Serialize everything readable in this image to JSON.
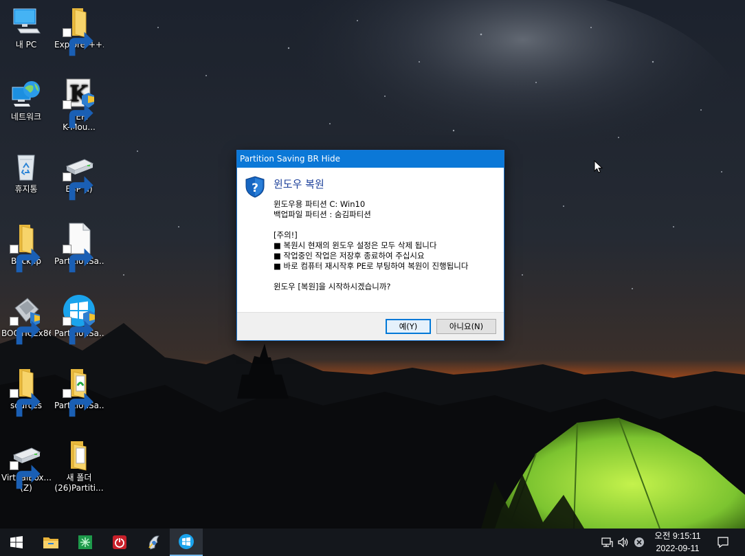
{
  "desktop": {
    "icons": [
      {
        "label": "내 PC",
        "icon": "this-pc-icon"
      },
      {
        "label": "Explorer++...",
        "icon": "folder-icon"
      },
      {
        "label": "네트워크",
        "icon": "network-icon"
      },
      {
        "label_line1": "UEFI",
        "label_line2": "K-Mou...",
        "icon": "k-mouse-icon"
      },
      {
        "label": "휴지통",
        "icon": "recycle-bin-icon"
      },
      {
        "label": "ESP (I)",
        "icon": "drive-icon"
      },
      {
        "label": "Backup",
        "icon": "folder-icon"
      },
      {
        "label": "PartitionSa...",
        "icon": "blank-file-icon"
      },
      {
        "label": "BOOTICEx86",
        "icon": "bootice-icon"
      },
      {
        "label": "PartitionSa...",
        "icon": "windows-logo-icon"
      },
      {
        "label": "sources",
        "icon": "folder-icon"
      },
      {
        "label": "PartitionSa...",
        "icon": "folder-doc-icon"
      },
      {
        "label_line1": "VirtualBox...",
        "label_line2": "(Z)",
        "icon": "drive-icon"
      },
      {
        "label_line1": "새 폴더",
        "label_line2": "(26)Partiti...",
        "icon": "folder-doc-icon"
      }
    ]
  },
  "dialog": {
    "title": "Partition Saving BR Hide",
    "icon": "question-shield-icon",
    "heading": "윈도우 복원",
    "lines": [
      "윈도우용 파티션  C:  Win10",
      "백업파일 파티션 : 숨김파티션",
      "",
      "[주의!]",
      "■ 복원시 현재의 윈도우 설정은 모두 삭제 됩니다",
      "■ 작업중인 작업은 저장후 종료하여 주십시요",
      "■ 바로 컴퓨터 재시작후 PE로 부팅하여 복원이 진행됩니다",
      "",
      "윈도우 [복원]을  시작하시겠습니까?"
    ],
    "yes_label": "예(Y)",
    "no_label": "아니요(N)"
  },
  "taskbar": {
    "buttons": [
      "start-icon",
      "file-explorer-icon",
      "spreadsheet-icon",
      "power-icon",
      "tool-icon",
      "partition-saving-icon"
    ],
    "tray": [
      "network-icon",
      "volume-icon",
      "close-circle-icon"
    ],
    "time": "오전 9:15:11",
    "date": "2022-09-11",
    "notification_icon": "notification-icon"
  },
  "colors": {
    "title_bar": "#0b78d7",
    "heading": "#1a3e99",
    "taskbar": "#14171c",
    "tent": "#8cd63b"
  }
}
